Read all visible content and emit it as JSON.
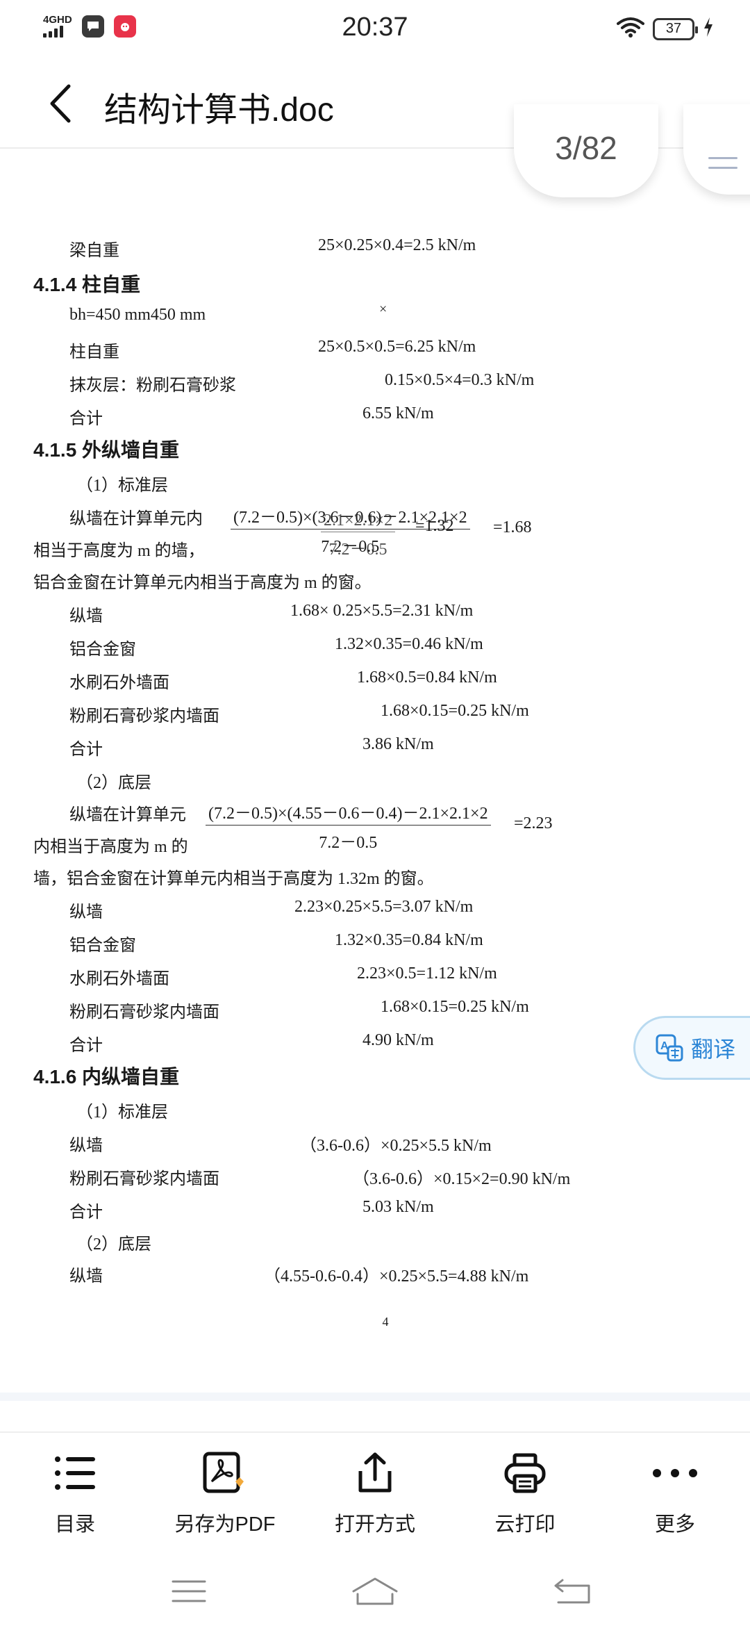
{
  "status_bar": {
    "network": "4GHD",
    "time": "20:37",
    "battery": "37"
  },
  "header": {
    "title": "结构计算书.doc"
  },
  "page_indicator": "3/82",
  "doc": {
    "l1": {
      "label": "梁自重",
      "value": "25×0.25×0.4=2.5 kN/m"
    },
    "h414": "4.1.4  柱自重",
    "l2": {
      "label": "bh=450 mm450 mm",
      "value": "×"
    },
    "l3": {
      "label": "柱自重",
      "value": "25×0.5×0.5=6.25 kN/m"
    },
    "l4": {
      "label": "抹灰层：粉刷石膏砂浆",
      "value": "0.15×0.5×4=0.3 kN/m"
    },
    "l5": {
      "label": "合计",
      "value": "6.55 kN/m"
    },
    "h415": "4.1.5  外纵墙自重",
    "std1": "（1）标准层",
    "p1a": "纵墙在计算单元内",
    "f1_num": "(7.2－0.5)×(3.6－0.6)－2.1×2.1×2",
    "f1_den": "7.2－0.5",
    "f1_res": "=1.68",
    "f1b_num": "2.1×2.1×2",
    "f1b_den": "7.2－0.5",
    "f1b_res": "=1.32",
    "p1b": "相当于高度为 m 的墙，",
    "p1c": "铝合金窗在计算单元内相当于高度为 m 的窗。",
    "a1": {
      "label": "纵墙",
      "value": "1.68× 0.25×5.5=2.31 kN/m"
    },
    "a2": {
      "label": "铝合金窗",
      "value": "1.32×0.35=0.46 kN/m"
    },
    "a3": {
      "label": "水刷石外墙面",
      "value": "1.68×0.5=0.84 kN/m"
    },
    "a4": {
      "label": "粉刷石膏砂浆内墙面",
      "value": "1.68×0.15=0.25 kN/m"
    },
    "a5": {
      "label": "合计",
      "value": "3.86 kN/m"
    },
    "bot1": "（2）底层",
    "p2a": "纵墙在计算单元",
    "f2_num": "(7.2－0.5)×(4.55－0.6－0.4)－2.1×2.1×2",
    "f2_den": "7.2－0.5",
    "f2_res": "=2.23",
    "p2b": "内相当于高度为 m 的",
    "p2c": "墙，铝合金窗在计算单元内相当于高度为 1.32m 的窗。",
    "b1": {
      "label": "纵墙",
      "value": "2.23×0.25×5.5=3.07 kN/m"
    },
    "b2": {
      "label": "铝合金窗",
      "value": "1.32×0.35=0.84 kN/m"
    },
    "b3": {
      "label": "水刷石外墙面",
      "value": "2.23×0.5=1.12 kN/m"
    },
    "b4": {
      "label": "粉刷石膏砂浆内墙面",
      "value": "1.68×0.15=0.25 kN/m"
    },
    "b5": {
      "label": "合计",
      "value": "4.90 kN/m"
    },
    "h416": "4.1.6  内纵墙自重",
    "std2": "（1）标准层",
    "c1": {
      "label": "纵墙",
      "value": "（3.6-0.6）×0.25×5.5 kN/m"
    },
    "c2": {
      "label": "粉刷石膏砂浆内墙面",
      "value": "（3.6-0.6）×0.15×2=0.90 kN/m"
    },
    "c3": {
      "label": "合计",
      "value": "5.03 kN/m"
    },
    "bot2": "（2）底层",
    "c4": {
      "label": "纵墙",
      "value": "（4.55-0.6-0.4）×0.25×5.5=4.88 kN/m"
    },
    "page_number": "4"
  },
  "translate_button": "翻译",
  "toolbar": {
    "toc": "目录",
    "save_pdf": "另存为PDF",
    "open_with": "打开方式",
    "cloud_print": "云打印",
    "more": "更多"
  }
}
